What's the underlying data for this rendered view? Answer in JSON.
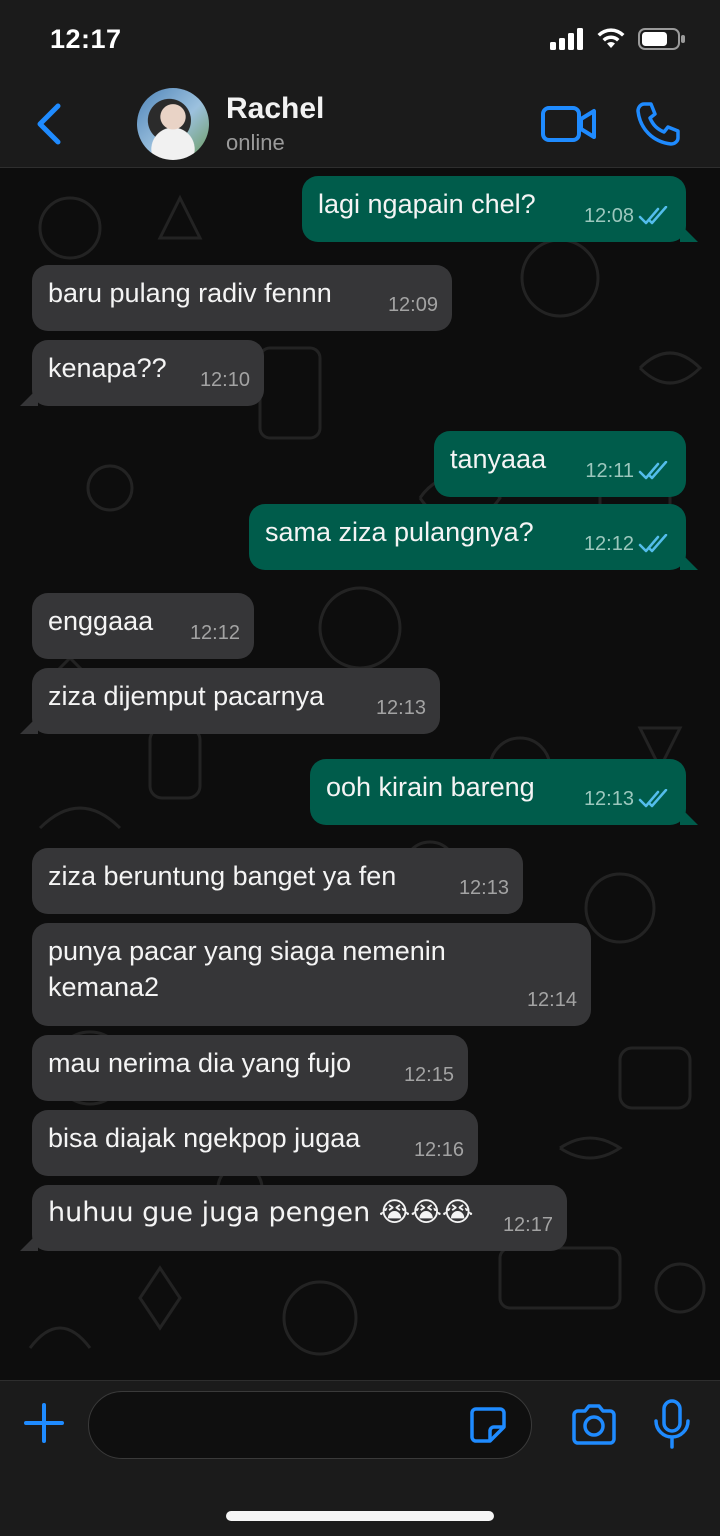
{
  "status_bar": {
    "time": "12:17"
  },
  "header": {
    "contact_name": "Rachel",
    "contact_status": "online"
  },
  "colors": {
    "accent": "#1f8bff",
    "outgoing_bubble": "#005c4b",
    "incoming_bubble": "#363638",
    "read_tick": "#53bdeb"
  },
  "messages": [
    {
      "dir": "out",
      "text": "lagi ngapain chel?",
      "time": "12:08"
    },
    {
      "dir": "in",
      "text": "baru pulang radiv fennn",
      "time": "12:09"
    },
    {
      "dir": "in",
      "text": "kenapa??",
      "time": "12:10"
    },
    {
      "dir": "out",
      "text": "tanyaaa",
      "time": "12:11"
    },
    {
      "dir": "out",
      "text": "sama ziza pulangnya?",
      "time": "12:12"
    },
    {
      "dir": "in",
      "text": "enggaaa",
      "time": "12:12"
    },
    {
      "dir": "in",
      "text": "ziza dijemput pacarnya",
      "time": "12:13"
    },
    {
      "dir": "out",
      "text": "ooh kirain bareng",
      "time": "12:13"
    },
    {
      "dir": "in",
      "text": "ziza beruntung banget ya fen",
      "time": "12:13"
    },
    {
      "dir": "in",
      "text": "punya pacar yang siaga nemenin\nkemana2",
      "time": "12:14"
    },
    {
      "dir": "in",
      "text": "mau nerima dia yang fujo",
      "time": "12:15"
    },
    {
      "dir": "in",
      "text": "bisa diajak ngekpop jugaa",
      "time": "12:16"
    },
    {
      "dir": "in",
      "text": "huhuu gue juga pengen 😭😭😭",
      "time": "12:17"
    }
  ],
  "input": {
    "value": "",
    "placeholder": ""
  },
  "icons": {
    "back": "chevron-left-icon",
    "video": "video-camera-icon",
    "call": "phone-icon",
    "plus": "plus-icon",
    "sticker": "sticker-icon",
    "camera": "camera-icon",
    "mic": "microphone-icon",
    "read": "double-check-icon"
  }
}
